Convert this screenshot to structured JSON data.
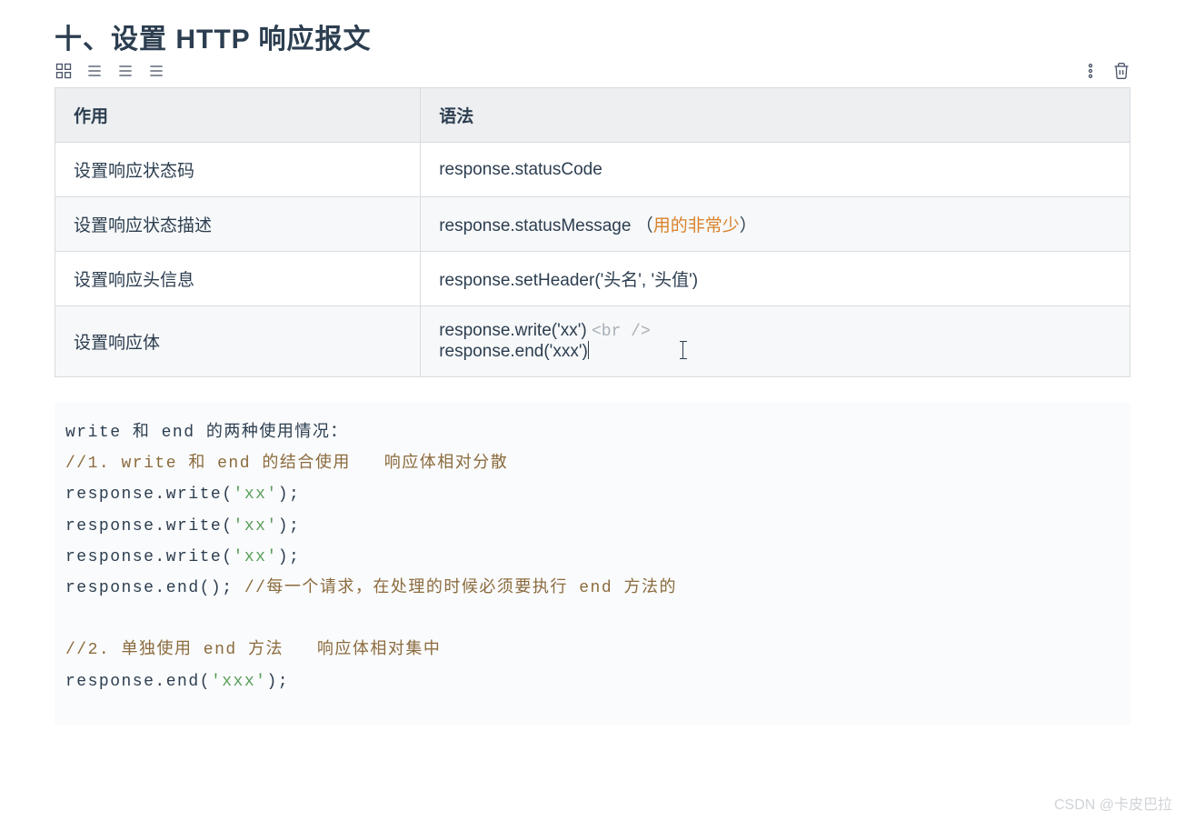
{
  "heading": "十、设置 HTTP 响应报文",
  "table": {
    "headers": [
      "作用",
      "语法"
    ],
    "rows": [
      {
        "c1": "设置响应状态码",
        "c2": "response.statusCode",
        "note": ""
      },
      {
        "c1": "设置响应状态描述",
        "c2": "response.statusMessage   （",
        "note": "用的非常少",
        "suffix": "）"
      },
      {
        "c1": "设置响应头信息",
        "c2": "response.setHeader('头名', '头值')",
        "note": ""
      },
      {
        "c1": "设置响应体",
        "c2_line1": "response.write('xx')  ",
        "c2_tag": "<br />",
        "c2_line2": "response.end('xxx')"
      }
    ]
  },
  "code": {
    "l1_a": "write ",
    "l1_b": "和 ",
    "l1_c": "end ",
    "l1_d": "的两种使用情况：",
    "l2": "//1. write 和 end 的结合使用   响应体相对分散",
    "l3_a": "response.write(",
    "l3_b": "'xx'",
    "l3_c": ");",
    "l4_a": "response.write(",
    "l4_b": "'xx'",
    "l4_c": ");",
    "l5_a": "response.write(",
    "l5_b": "'xx'",
    "l5_c": ");",
    "l6_a": "response.end(); ",
    "l6_b": "//每一个请求，在处理的时候必须要执行 end 方法的",
    "l8": "//2. 单独使用 end 方法   响应体相对集中",
    "l9_a": "response.end(",
    "l9_b": "'xxx'",
    "l9_c": ");"
  },
  "watermark": "CSDN @卡皮巴拉"
}
